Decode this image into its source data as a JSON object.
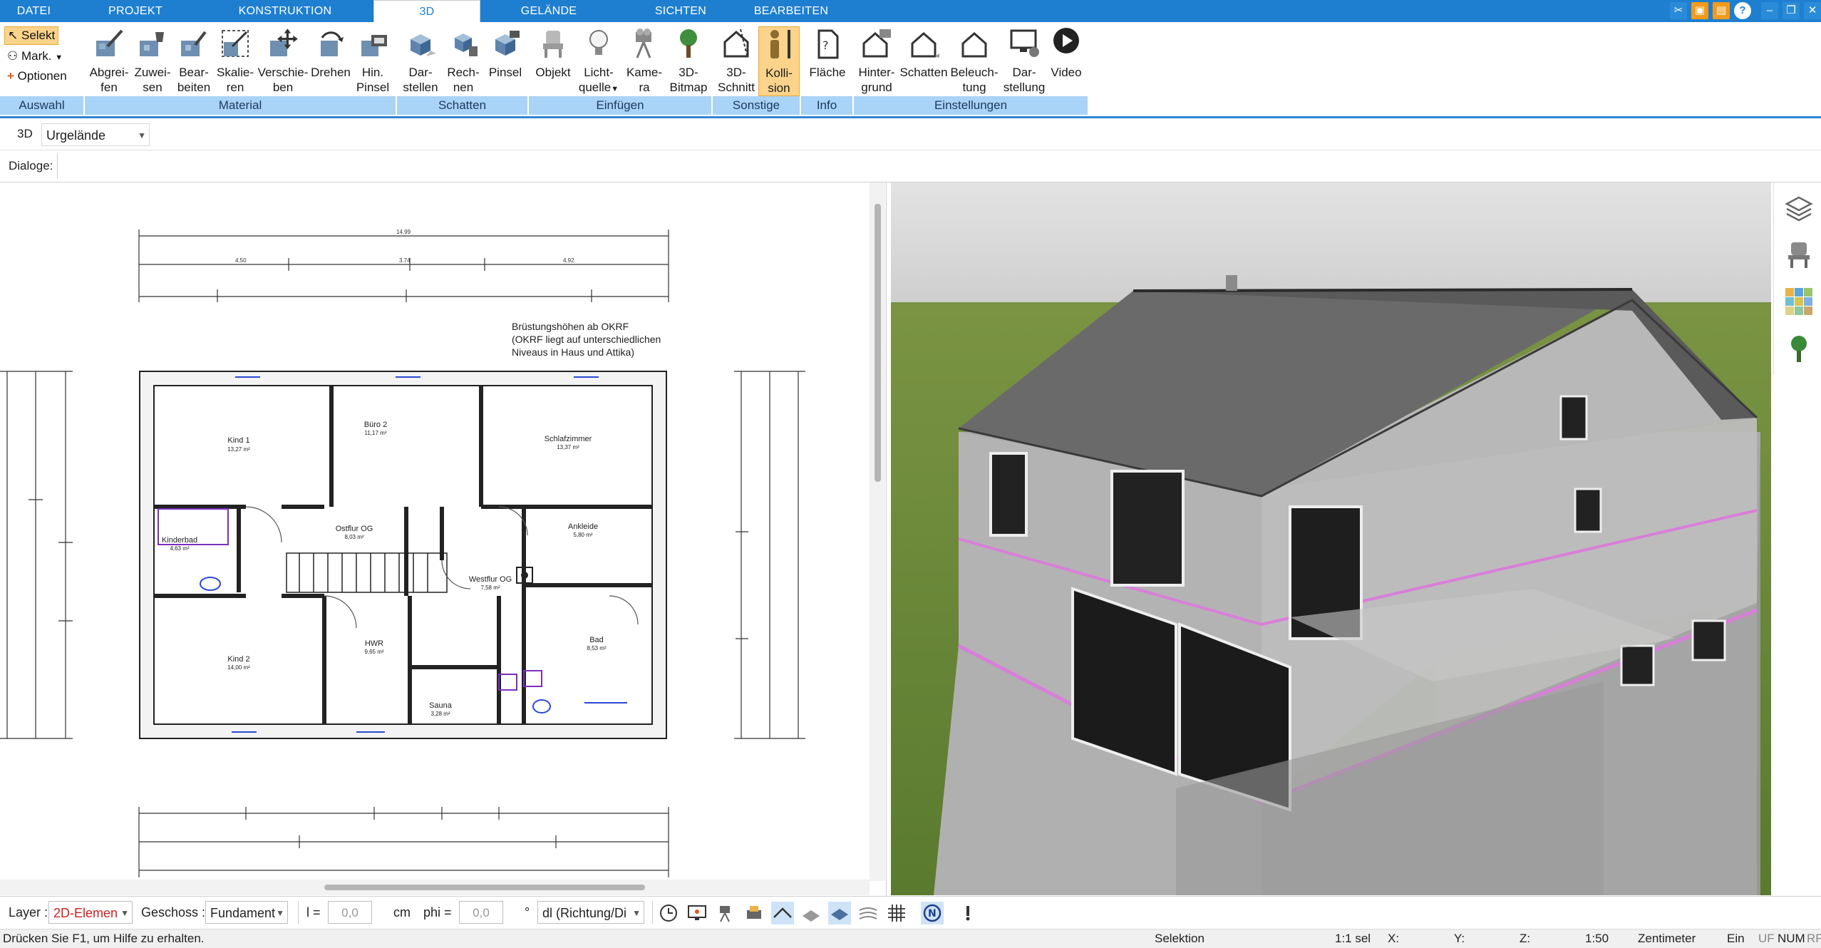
{
  "menu_tabs": {
    "datei": "DATEI",
    "projekt": "PROJEKT",
    "konstruktion": "KONSTRUKTION",
    "d3": "3D",
    "gelaende": "GELÄNDE",
    "sichten": "SICHTEN",
    "bearbeiten": "BEARBEITEN"
  },
  "ribbon": {
    "auswahl": {
      "label": "Auswahl",
      "selekt": "Selekt",
      "mark": "Mark.",
      "optionen": "Optionen"
    },
    "material": {
      "label": "Material",
      "buttons": [
        {
          "l1": "Abgrei-",
          "l2": "fen"
        },
        {
          "l1": "Zuwei-",
          "l2": "sen"
        },
        {
          "l1": "Bear-",
          "l2": "beiten"
        },
        {
          "l1": "Skalie-",
          "l2": "ren"
        },
        {
          "l1": "Verschie-",
          "l2": "ben"
        },
        {
          "l1": "Drehen",
          "l2": ""
        },
        {
          "l1": "Hin.",
          "l2": "Pinsel"
        }
      ]
    },
    "schatten": {
      "label": "Schatten",
      "buttons": [
        {
          "l1": "Dar-",
          "l2": "stellen"
        },
        {
          "l1": "Rech-",
          "l2": "nen"
        },
        {
          "l1": "Pinsel",
          "l2": ""
        }
      ]
    },
    "einfuegen": {
      "label": "Einfügen",
      "buttons": [
        {
          "l1": "Objekt",
          "l2": ""
        },
        {
          "l1": "Licht-",
          "l2": "quelle"
        },
        {
          "l1": "Kame-",
          "l2": "ra"
        },
        {
          "l1": "3D-",
          "l2": "Bitmap"
        }
      ]
    },
    "sonstige": {
      "label": "Sonstige",
      "buttons": [
        {
          "l1": "3D-",
          "l2": "Schnitt"
        },
        {
          "l1": "Kolli-",
          "l2": "sion"
        }
      ]
    },
    "info": {
      "label": "Info",
      "buttons": [
        {
          "l1": "Fläche",
          "l2": ""
        }
      ]
    },
    "einstellungen": {
      "label": "Einstellungen",
      "buttons": [
        {
          "l1": "Hinter-",
          "l2": "grund"
        },
        {
          "l1": "Schatten",
          "l2": ""
        },
        {
          "l1": "Beleuch-",
          "l2": "tung"
        },
        {
          "l1": "Dar-",
          "l2": "stellung"
        },
        {
          "l1": "Video",
          "l2": ""
        }
      ]
    }
  },
  "bar3d": {
    "label": "3D",
    "value": "Urgelände"
  },
  "dialoge": {
    "label": "Dialoge:"
  },
  "plan": {
    "note_line1": "Brüstungshöhen ab OKRF",
    "note_line2": "(OKRF liegt auf unterschiedlichen",
    "note_line3": "Niveaus in Haus und Attika)",
    "dims_top": [
      "14.99",
      "4.50",
      "3.74",
      "4.92"
    ],
    "rooms": [
      {
        "name": "Kind 1",
        "area": "13,27 m²"
      },
      {
        "name": "Büro 2",
        "area": "11,17 m²"
      },
      {
        "name": "Schlafzimmer",
        "area": "13,37 m²"
      },
      {
        "name": "Kinderbad",
        "area": "4,63 m²"
      },
      {
        "name": "Ostflur OG",
        "area": "8,03 m²"
      },
      {
        "name": "Ankleide",
        "area": "5,80 m²"
      },
      {
        "name": "Westflur OG",
        "area": "7,58 m²"
      },
      {
        "name": "Kind 2",
        "area": "14,00 m²"
      },
      {
        "name": "HWR",
        "area": "9,65 m²"
      },
      {
        "name": "Bad",
        "area": "8,53 m²"
      },
      {
        "name": "Sauna",
        "area": "3,28 m²"
      }
    ]
  },
  "status_controls": {
    "layer_label": "Layer :",
    "layer_value": "2D-Elemen",
    "geschoss_label": "Geschoss :",
    "geschoss_value": "Fundament",
    "l_label": "l =",
    "l_value": "0,0",
    "l_unit": "cm",
    "phi_label": "phi =",
    "phi_value": "0,0",
    "phi_unit": "°",
    "dl_value": "dl (Richtung/Di"
  },
  "statusbar": {
    "help": "Drücken Sie F1, um Hilfe zu erhalten.",
    "selektion": "Selektion",
    "sel_count": "1:1 sel",
    "x": "X:",
    "y": "Y:",
    "z": "Z:",
    "scale": "1:50",
    "unit": "Zentimeter",
    "ein": "Ein",
    "uf": "UF",
    "num": "NUM",
    "rf": "RF"
  },
  "colors": {
    "accent": "#1e7fd0",
    "ribbon_group": "#a9d3f7",
    "selected": "#fbd38a",
    "grass": "#6e8b3d",
    "sky": "#d8d8d8"
  }
}
